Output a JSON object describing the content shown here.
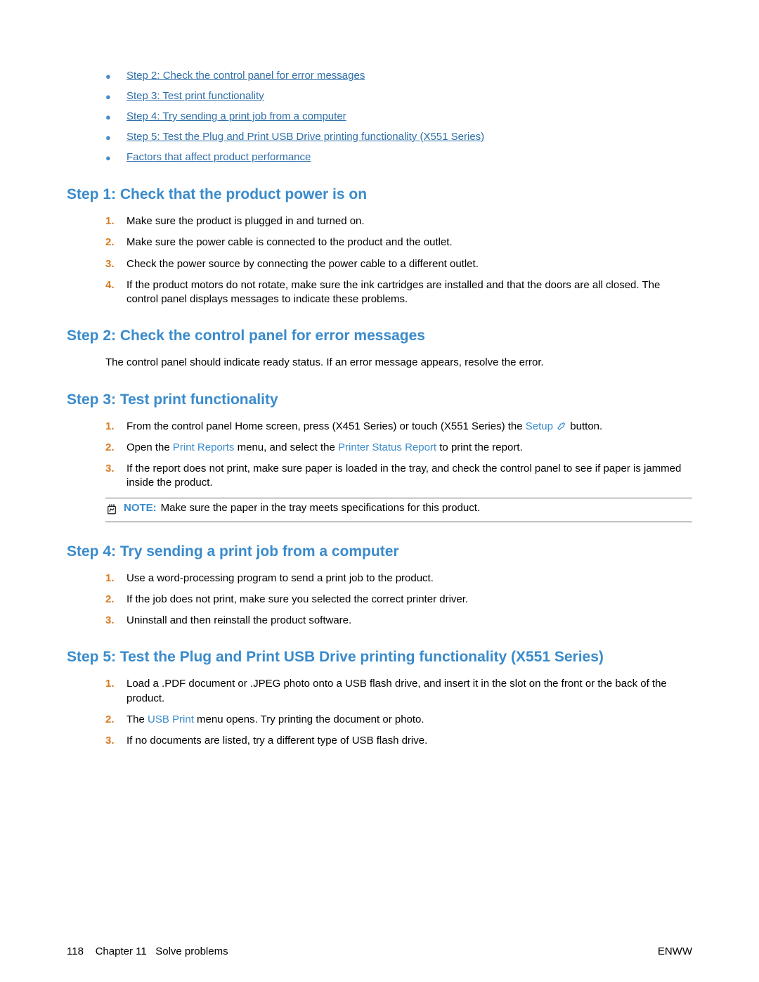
{
  "toc": [
    "Step 2: Check the control panel for error messages",
    "Step 3: Test print functionality",
    "Step 4: Try sending a print job from a computer",
    "Step 5: Test the Plug and Print USB Drive printing functionality (X551 Series)",
    "Factors that affect product performance"
  ],
  "sections": {
    "s1": {
      "title": "Step 1: Check that the product power is on",
      "items": [
        "Make sure the product is plugged in and turned on.",
        "Make sure the power cable is connected to the product and the outlet.",
        "Check the power source by connecting the power cable to a different outlet.",
        "If the product motors do not rotate, make sure the ink cartridges are installed and that the doors are all closed. The control panel displays messages to indicate these problems."
      ]
    },
    "s2": {
      "title": "Step 2: Check the control panel for error messages",
      "body": "The control panel should indicate ready status. If an error message appears, resolve the error."
    },
    "s3": {
      "title": "Step 3: Test print functionality",
      "li1_a": "From the control panel Home screen, press (X451 Series) or touch (X551 Series) the ",
      "li1_setup": "Setup",
      "li1_b": " button.",
      "li2_a": "Open the ",
      "li2_pr": "Print Reports",
      "li2_b": " menu, and select the ",
      "li2_psr": "Printer Status Report",
      "li2_c": " to print the report.",
      "li3": "If the report does not print, make sure paper is loaded in the tray, and check the control panel to see if paper is jammed inside the product.",
      "note_label": "NOTE:",
      "note_body": "Make sure the paper in the tray meets specifications for this product."
    },
    "s4": {
      "title": "Step 4: Try sending a print job from a computer",
      "items": [
        "Use a word-processing program to send a print job to the product.",
        "If the job does not print, make sure you selected the correct printer driver.",
        "Uninstall and then reinstall the product software."
      ]
    },
    "s5": {
      "title": "Step 5: Test the Plug and Print USB Drive printing functionality (X551 Series)",
      "li1": "Load a .PDF document or .JPEG photo onto a USB flash drive, and insert it in the slot on the front or the back of the product.",
      "li2_a": "The ",
      "li2_usb": "USB Print",
      "li2_b": " menu opens. Try printing the document or photo.",
      "li3": "If no documents are listed, try a different type of USB flash drive."
    }
  },
  "footer": {
    "page": "118",
    "chapter_label": "Chapter 11",
    "chapter_title": "Solve problems",
    "right": "ENWW"
  }
}
